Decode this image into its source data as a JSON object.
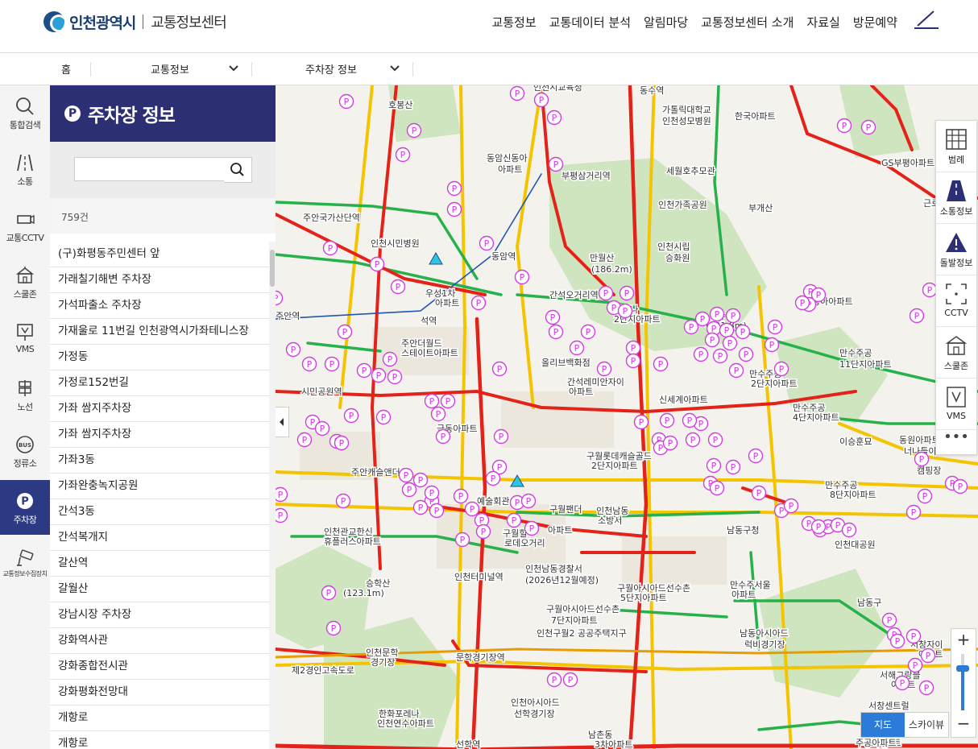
{
  "header": {
    "logo_city": "인천광역시",
    "logo_center": "교통정보센터",
    "nav": [
      "교통정보",
      "교통데이터 분석",
      "알림마당",
      "교통정보센터 소개",
      "자료실",
      "방문예약"
    ]
  },
  "breadcrumb": {
    "home": "홈",
    "level1": "교통정보",
    "level2": "주차장 정보"
  },
  "rail": [
    {
      "label": "통합검색",
      "icon": "search-icon"
    },
    {
      "label": "소통",
      "icon": "road-icon"
    },
    {
      "label": "교통CCTV",
      "icon": "cctv-icon"
    },
    {
      "label": "스쿨존",
      "icon": "school-icon"
    },
    {
      "label": "VMS",
      "icon": "vms-icon"
    },
    {
      "label": "노선",
      "icon": "route-icon"
    },
    {
      "label": "정류소",
      "icon": "bus-stop-icon"
    },
    {
      "label": "주차장",
      "icon": "parking-icon",
      "active": true
    },
    {
      "label": "교통정보수집장치",
      "icon": "sensor-icon"
    }
  ],
  "panel": {
    "badge": "P",
    "title": "주차장 정보",
    "search_placeholder": "",
    "count": "759건",
    "items": [
      "(구)화평동주민센터 앞",
      "가래칠기해변 주차장",
      "가석파출소 주차장",
      "가재울로 11번길 인천광역시가좌테니스장",
      "가정동",
      "가정로152번길",
      "가좌 쌈지주차장",
      "가좌 쌈지주차장",
      "가좌3동",
      "가좌완충녹지공원",
      "간석3동",
      "간석복개지",
      "갈산역",
      "갈월산",
      "강남시장 주차장",
      "강화역사관",
      "강화종합전시관",
      "강화평화전망대",
      "개항로",
      "개항로"
    ]
  },
  "tools": [
    {
      "label": "범례",
      "icon": "legend-icon"
    },
    {
      "label": "소통정보",
      "icon": "traffic-icon"
    },
    {
      "label": "돌발정보",
      "icon": "incident-icon"
    },
    {
      "label": "CCTV",
      "icon": "cctv-frame-icon"
    },
    {
      "label": "스쿨존",
      "icon": "school-icon"
    },
    {
      "label": "VMS",
      "icon": "vms-icon"
    }
  ],
  "tools_more": "•••",
  "zoom": {
    "in": "+",
    "out": "−"
  },
  "maptype": {
    "map": "지도",
    "sky": "스카이뷰"
  },
  "map_labels": [
    "호봉산",
    "가톨릭대학교",
    "인천성모병원",
    "한국아파트",
    "동암신동아",
    "아파트",
    "부평삼거리역",
    "세월호추모관",
    "인천가족공원",
    "부개산",
    "인천시립",
    "승화원",
    "만월산",
    "(186.2m)",
    "동암역",
    "간석오거리역",
    "간석나",
    "2단지아파트",
    "만수산",
    "(201.8m)",
    "동아아파트",
    "만수주공",
    "11단지아파트",
    "주안역",
    "석역",
    "주안더월드",
    "스테이트아파트",
    "올리브백화점",
    "간석레미안자이",
    "아파트",
    "신세계아파트",
    "만수주공",
    "2단지아파트",
    "만수주공",
    "4단지아파트",
    "이승훈묘",
    "극동아파트",
    "구월롯데캐슬골드",
    "2단지아파트",
    "예술회관",
    "구월팬더",
    "아파트",
    "인천남동",
    "소방서",
    "남동구청",
    "인천관교한신",
    "휴플러스아파트",
    "구월힐",
    "로데오거리",
    "인천터미널역",
    "인천남동경찰서",
    "(2026년12월예정)",
    "구월아시아드선수촌",
    "5단지아파트",
    "승학산",
    "(123.1m)",
    "만수주서울",
    "아파트",
    "구월아시아드선수촌",
    "7단지아파트",
    "인천구월2 공공주택지구",
    "남동구",
    "인천문학",
    "경기장",
    "문학경기장역",
    "남동아시아드",
    "럭비경기장",
    "서창자이",
    "아파트",
    "서해그랑블",
    "아파트",
    "한화포레나",
    "인천연수아파트",
    "인천아시아드",
    "선학경기장",
    "남촌동",
    "3차아파트",
    "서창센트럴",
    "더포레스트",
    "선학역",
    "제2경인고속도로",
    "만수주공",
    "8단지아파트",
    "인천시교육청",
    "동수역",
    "주안국가산단역",
    "우성1차",
    "아파트",
    "인천시민병원",
    "시민공원역",
    "주안캐슬앤더샵",
    "인천대공원",
    "GS부평아파트",
    "근로",
    "동원아파트",
    "너나들이",
    "캠핑장",
    "주공아파트",
    "더포레스트"
  ]
}
